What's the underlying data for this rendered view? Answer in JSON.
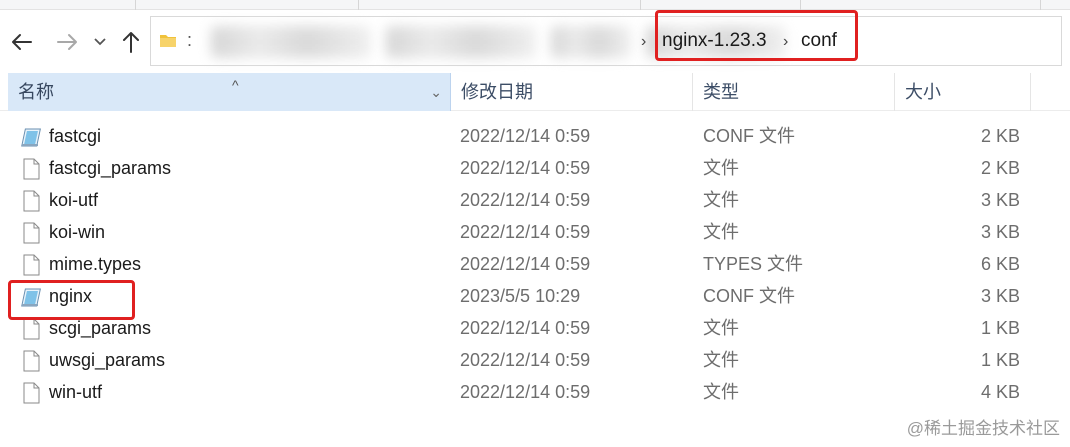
{
  "window": {
    "title": "conf"
  },
  "address_bar": {
    "path": [
      "nginx-1.23.3",
      "conf"
    ],
    "separator": "›"
  },
  "nav": {
    "back_icon": "back-arrow-icon",
    "forward_icon": "forward-arrow-icon",
    "recent_icon": "chevron-down-icon",
    "up_icon": "up-arrow-icon"
  },
  "columns": {
    "name": "名称",
    "date": "修改日期",
    "type": "类型",
    "size": "大小"
  },
  "files": [
    {
      "name": "fastcgi",
      "date": "2022/12/14 0:59",
      "type": "CONF 文件",
      "size": "2 KB",
      "icon": "conf-file-icon"
    },
    {
      "name": "fastcgi_params",
      "date": "2022/12/14 0:59",
      "type": "文件",
      "size": "2 KB",
      "icon": "blank-file-icon"
    },
    {
      "name": "koi-utf",
      "date": "2022/12/14 0:59",
      "type": "文件",
      "size": "3 KB",
      "icon": "blank-file-icon"
    },
    {
      "name": "koi-win",
      "date": "2022/12/14 0:59",
      "type": "文件",
      "size": "3 KB",
      "icon": "blank-file-icon"
    },
    {
      "name": "mime.types",
      "date": "2022/12/14 0:59",
      "type": "TYPES 文件",
      "size": "6 KB",
      "icon": "blank-file-icon"
    },
    {
      "name": "nginx",
      "date": "2023/5/5 10:29",
      "type": "CONF 文件",
      "size": "3 KB",
      "icon": "conf-file-icon"
    },
    {
      "name": "scgi_params",
      "date": "2022/12/14 0:59",
      "type": "文件",
      "size": "1 KB",
      "icon": "blank-file-icon"
    },
    {
      "name": "uwsgi_params",
      "date": "2022/12/14 0:59",
      "type": "文件",
      "size": "1 KB",
      "icon": "blank-file-icon"
    },
    {
      "name": "win-utf",
      "date": "2022/12/14 0:59",
      "type": "文件",
      "size": "4 KB",
      "icon": "blank-file-icon"
    }
  ],
  "highlight_color": "#e02020",
  "header_selected_color": "#d9e8f8",
  "watermark": "@稀土掘金技术社区"
}
